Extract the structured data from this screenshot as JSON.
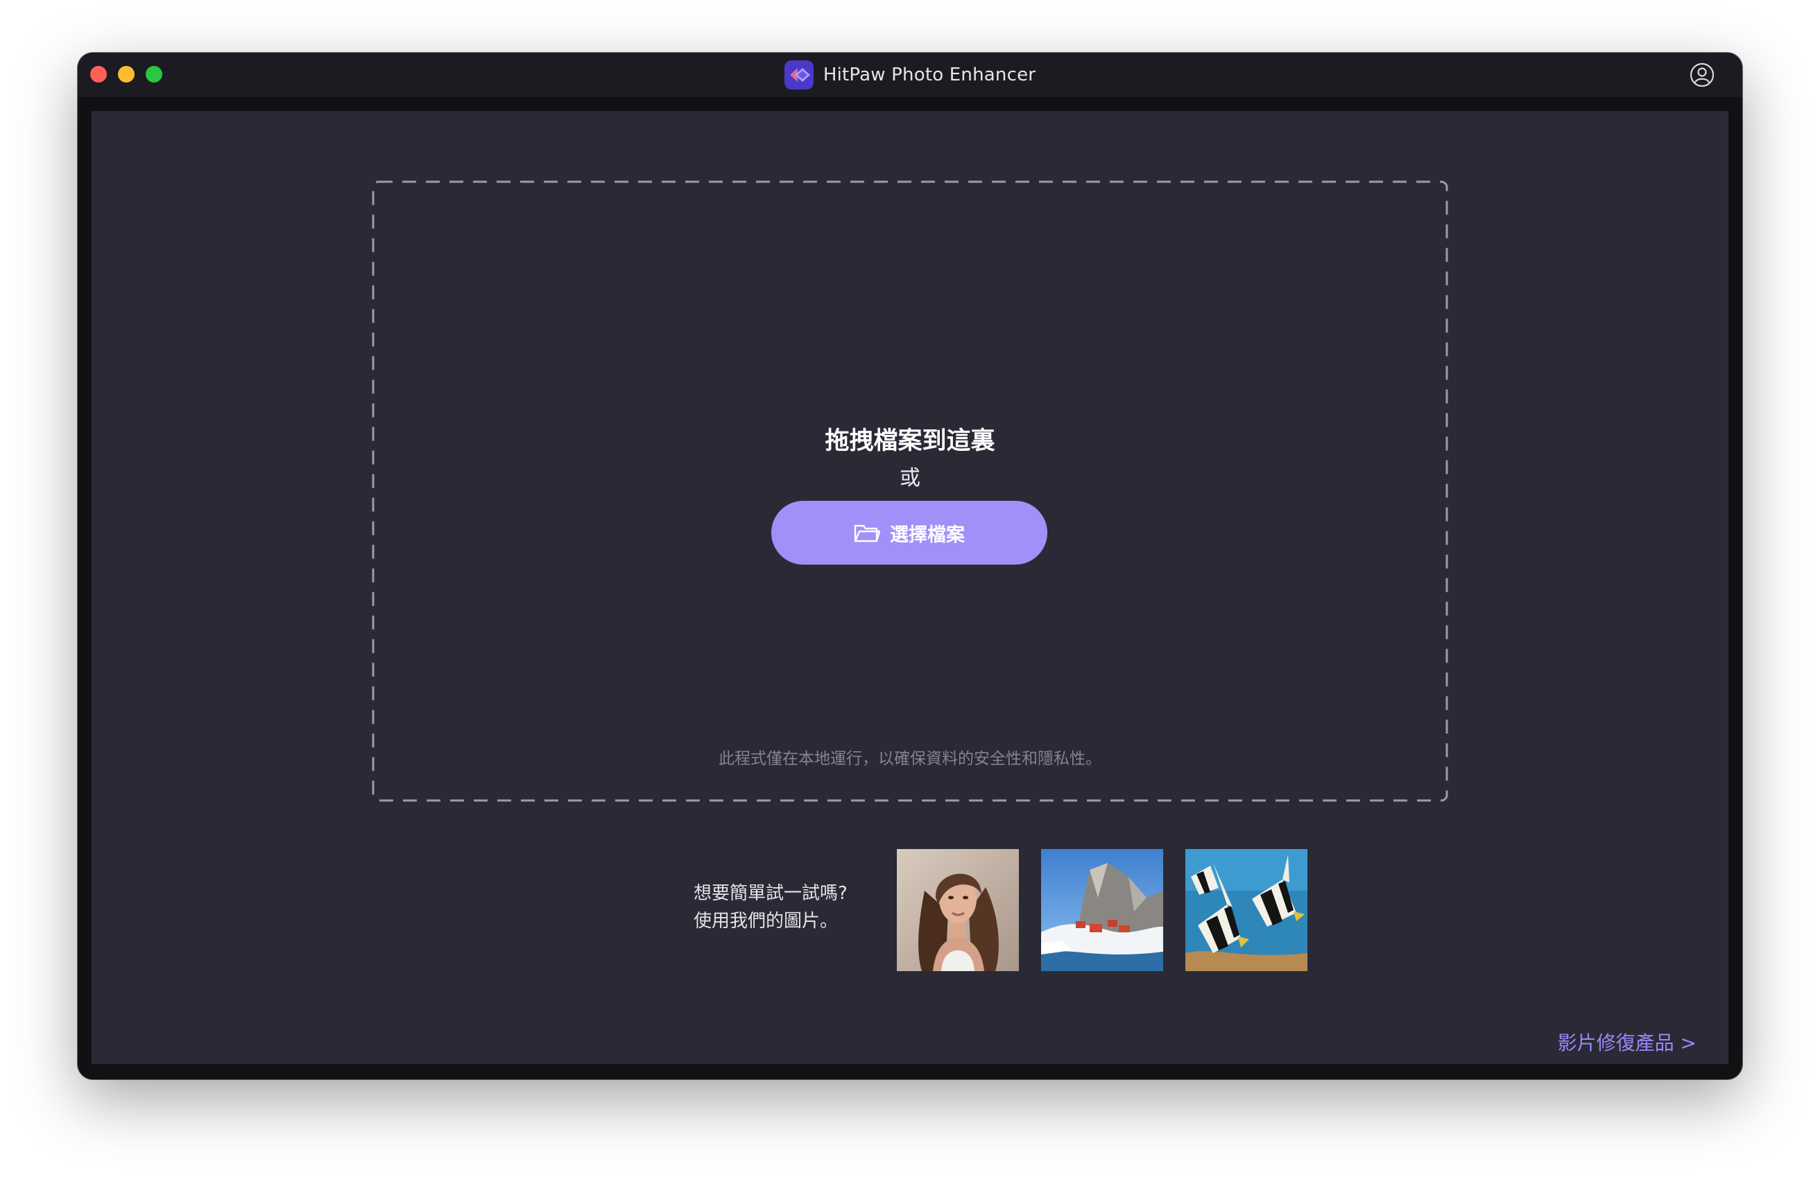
{
  "window": {
    "title": "HitPaw Photo Enhancer"
  },
  "dropzone": {
    "title": "拖拽檔案到這裏",
    "or": "或",
    "select_button": "選擇檔案",
    "privacy_note": "此程式僅在本地運行，以確保資料的安全性和隱私性。"
  },
  "samples": {
    "prompt_line1": "想要簡單試一試嗎?",
    "prompt_line2": "使用我們的圖片。",
    "images": [
      "portrait-woman",
      "snowy-mountain-village",
      "striped-fish"
    ]
  },
  "footer": {
    "video_link": "影片修復產品 >"
  },
  "colors": {
    "accent": "#a190f7",
    "link": "#9a88f5",
    "main_bg": "#292a35",
    "titlebar_bg": "#1b1b21"
  }
}
